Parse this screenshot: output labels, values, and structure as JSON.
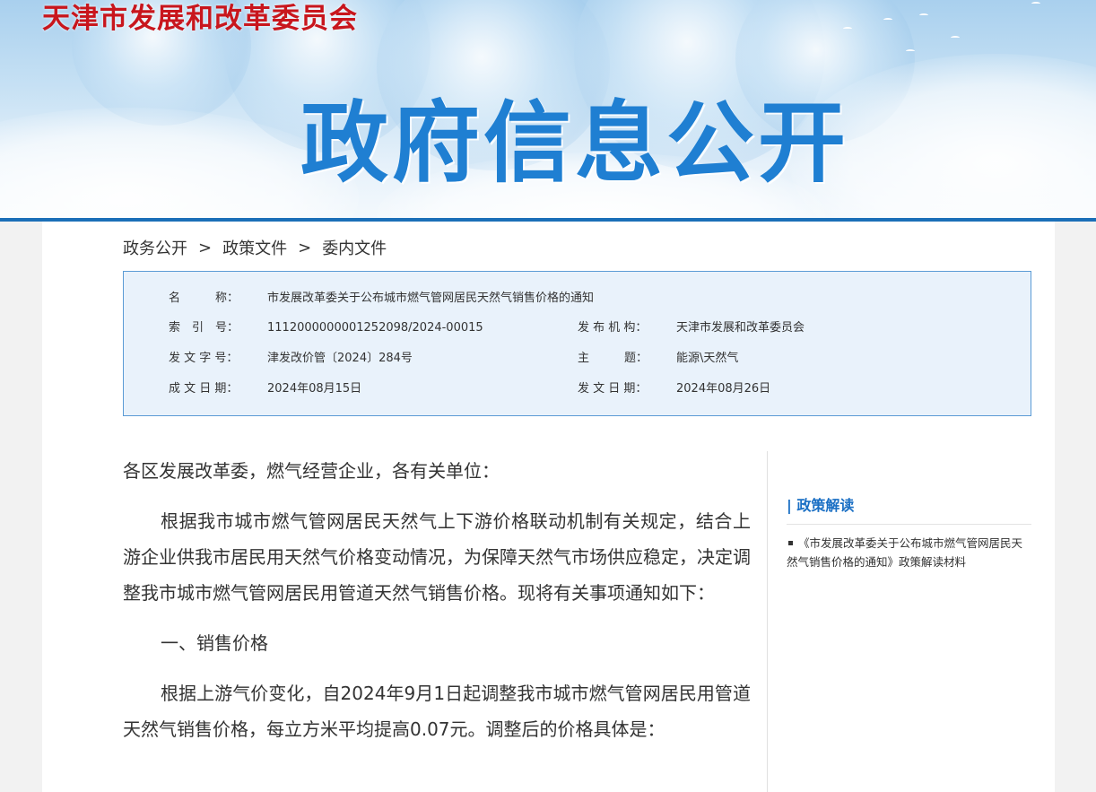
{
  "header": {
    "site_name": "天津市发展和改革委员会",
    "banner_title": "政府信息公开"
  },
  "breadcrumb": {
    "items": [
      "政务公开",
      "政策文件",
      "委内文件"
    ],
    "separator": ">"
  },
  "meta": {
    "name_label": "名　　　称：",
    "name_value": "市发展改革委关于公布城市燃气管网居民天然气销售价格的通知",
    "index_label": "索　引　号：",
    "index_value": "1112000000001252098/2024-00015",
    "issuer_label": "发 布 机 构：",
    "issuer_value": "天津市发展和改革委员会",
    "docno_label": "发 文 字 号：",
    "docno_value": "津发改价管〔2024〕284号",
    "topic_label": "主　　　题：",
    "topic_value": "能源\\天然气",
    "created_label": "成 文 日 期：",
    "created_value": "2024年08月15日",
    "published_label": "发 文 日 期：",
    "published_value": "2024年08月26日"
  },
  "article": {
    "salutation": "各区发展改革委，燃气经营企业，各有关单位：",
    "para1": "根据我市城市燃气管网居民天然气上下游价格联动机制有关规定，结合上游企业供我市居民用天然气价格变动情况，为保障天然气市场供应稳定，决定调整我市城市燃气管网居民用管道天然气销售价格。现将有关事项通知如下：",
    "section1": "一、销售价格",
    "para2": "根据上游气价变化，自2024年9月1日起调整我市城市燃气管网居民用管道天然气销售价格，每立方米平均提高0.07元。调整后的价格具体是："
  },
  "sidebar": {
    "title": "| 政策解读",
    "items": [
      "《市发展改革委关于公布城市燃气管网居民天然气销售价格的通知》政策解读材料"
    ]
  },
  "colors": {
    "site_name": "#c8161d",
    "banner_title": "#1f7fd2",
    "banner_line": "#1b6fb8",
    "meta_border": "#5b9bd5",
    "meta_bg": "#e9f2fb",
    "side_title": "#1a6fc4"
  }
}
